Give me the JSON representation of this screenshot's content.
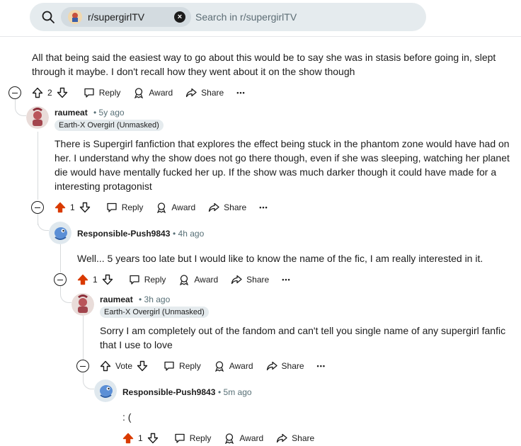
{
  "search": {
    "chip_label": "r/supergirlTV",
    "placeholder": "Search in r/supergirlTV"
  },
  "colors": {
    "upvote_active": "#d93a00",
    "thread_line": "#d7dadc"
  },
  "labels": {
    "reply": "Reply",
    "award": "Award",
    "share": "Share",
    "more": "•••",
    "vote": "Vote"
  },
  "comments": [
    {
      "text": "All that being said the easiest way to go about this would be to say she was in stasis before going in, slept through it maybe. I don't recall how they went about it on the show though",
      "score": "2"
    },
    {
      "author": "raumeat",
      "time": "• 5y ago",
      "flair": "Earth-X Overgirl (Unmasked)",
      "text": "There is Supergirl fanfiction that explores the effect being stuck in the phantom zone would have had on her. I understand why the show does not go there though, even if she was sleeping, watching her planet die would have mentally fucked her up. If the show was much darker though it could have made for a interesting protagonist",
      "score": "1",
      "upvoted": true
    },
    {
      "author": "Responsible-Push9843",
      "time": "• 4h ago",
      "text": "Well... 5 years too late but I would like to know the name of the fic, I am really interested in it.",
      "score": "1",
      "upvoted": true
    },
    {
      "author": "raumeat",
      "time": "• 3h ago",
      "flair": "Earth-X Overgirl (Unmasked)",
      "text": "Sorry I am completely out of the fandom and can't tell you single name of any supergirl fanfic that I use to love",
      "score": "Vote"
    },
    {
      "author": "Responsible-Push9843",
      "time": "• 5m ago",
      "text": ": (",
      "score": "1",
      "upvoted": true
    }
  ]
}
